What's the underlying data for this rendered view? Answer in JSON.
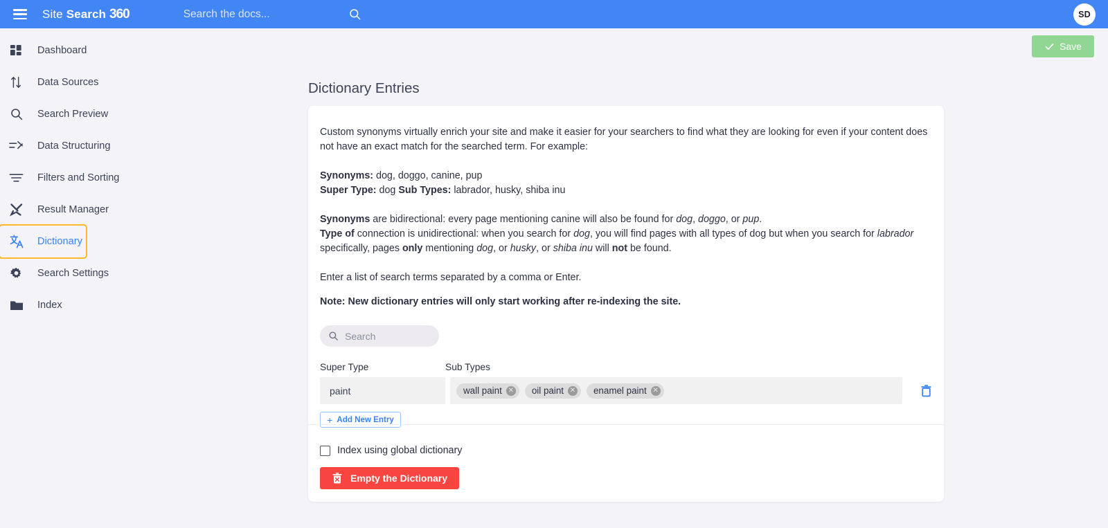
{
  "topbar": {
    "menu_icon": "hamburger-icon",
    "brand_site": "Site",
    "brand_search": "Search",
    "brand_360": "360",
    "search_placeholder": "Search the docs...",
    "search_value": "",
    "search_icon": "search-icon",
    "avatar_initials": "SD",
    "bg_color": "#4285f4"
  },
  "sidebar": {
    "items": [
      {
        "label": "Dashboard",
        "icon": "dashboard-icon"
      },
      {
        "label": "Data Sources",
        "icon": "arrows-updown-icon"
      },
      {
        "label": "Search Preview",
        "icon": "search-icon"
      },
      {
        "label": "Data Structuring",
        "icon": "data-structuring-icon"
      },
      {
        "label": "Filters and Sorting",
        "icon": "filter-icon"
      },
      {
        "label": "Result Manager",
        "icon": "tools-icon"
      },
      {
        "label": "Dictionary",
        "icon": "translate-icon"
      },
      {
        "label": "Search Settings",
        "icon": "gear-icon"
      },
      {
        "label": "Index",
        "icon": "folder-icon"
      }
    ],
    "active_index": 6,
    "active_outline_color": "#fcb72b",
    "active_text_color": "#3b82f6"
  },
  "toolbar": {
    "save_label": "Save",
    "save_icon": "check-icon",
    "save_color": "#92d694"
  },
  "main": {
    "page_title": "Dictionary Entries",
    "intro_paragraph": "Custom synonyms virtually enrich your site and make it easier for your searchers to find what they are looking for even if your content does not have an exact match for the searched term. For example:",
    "example": {
      "synonyms_label": "Synonyms:",
      "synonyms_value": " dog, doggo, canine, pup",
      "super_type_label": "Super Type:",
      "super_type_value": " dog ",
      "sub_types_label": "Sub Types:",
      "sub_types_value": " labrador, husky, shiba inu"
    },
    "explain": {
      "l1_b": "Synonyms",
      "l1_t1": " are bidirectional: every page mentioning canine will also be found for ",
      "l1_i1": "dog",
      "l1_t2": ", ",
      "l1_i2": "doggo",
      "l1_t3": ", or ",
      "l1_i3": "pup",
      "l1_t4": ".",
      "l2_b": "Type of",
      "l2_t1": " connection is unidirectional: when you search for ",
      "l2_i1": "dog",
      "l2_t2": ", you will find pages with all types of dog but when you search for ",
      "l2_i2": "labrador",
      "l2_t3": " specifically, pages ",
      "l2_b2": "only",
      "l2_t4": " mentioning ",
      "l2_i3": "dog",
      "l2_t5": ", or ",
      "l2_i4": "husky",
      "l2_t6": ", or ",
      "l2_i5": "shiba inu",
      "l2_t7": " will ",
      "l2_b3": "not",
      "l2_t8": " be found."
    },
    "instruction": "Enter a list of search terms separated by a comma or Enter.",
    "note": "Note: New dictionary entries will only start working after re-indexing the site.",
    "search": {
      "placeholder": "Search",
      "value": "",
      "icon": "search-icon"
    },
    "table": {
      "col_super_type": "Super Type",
      "col_sub_types": "Sub Types",
      "rows": [
        {
          "super_type": "paint",
          "sub_types": [
            "wall paint",
            "oil paint",
            "enamel paint"
          ],
          "delete_icon": "trash-icon"
        }
      ]
    },
    "add_new_entry_label": "Add New Entry",
    "add_new_entry_plus": "+",
    "footer": {
      "checkbox_label": "Index using global dictionary",
      "checkbox_checked": false,
      "empty_button_label": "Empty the Dictionary",
      "empty_button_icon": "trash-x-icon",
      "empty_button_color": "#f8453f"
    }
  }
}
